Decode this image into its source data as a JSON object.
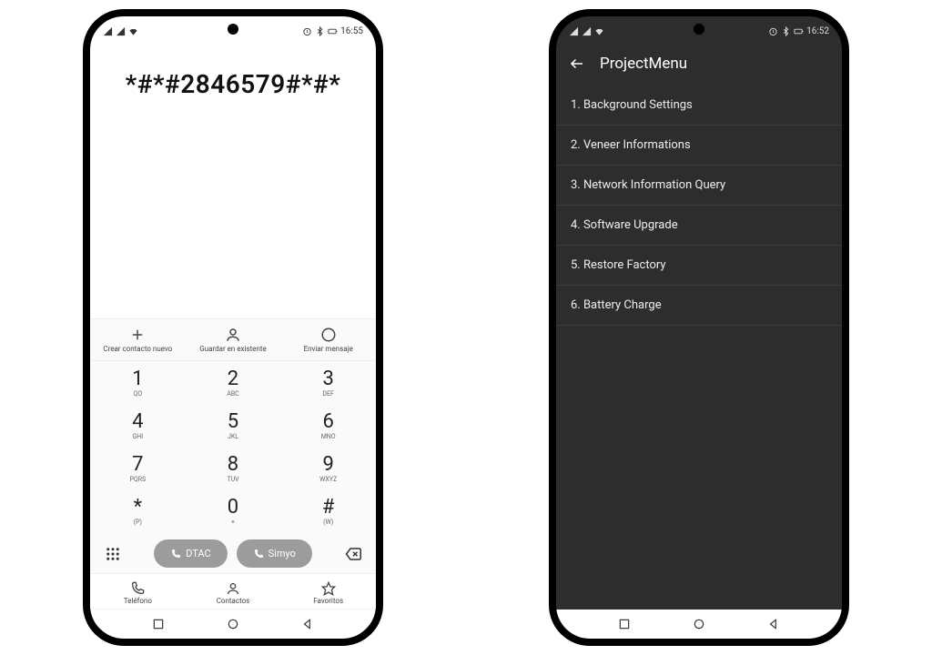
{
  "phone1": {
    "status": {
      "time": "16:55"
    },
    "dialed": "*#*#2846579#*#*",
    "actions": {
      "new_contact": "Crear contacto nuevo",
      "save_existing": "Guardar en existente",
      "send_message": "Enviar mensaje"
    },
    "keypad": [
      {
        "digit": "1",
        "letters": "QO"
      },
      {
        "digit": "2",
        "letters": "ABC"
      },
      {
        "digit": "3",
        "letters": "DEF"
      },
      {
        "digit": "4",
        "letters": "GHI"
      },
      {
        "digit": "5",
        "letters": "JKL"
      },
      {
        "digit": "6",
        "letters": "MNO"
      },
      {
        "digit": "7",
        "letters": "PQRS"
      },
      {
        "digit": "8",
        "letters": "TUV"
      },
      {
        "digit": "9",
        "letters": "WXYZ"
      },
      {
        "digit": "*",
        "letters": "(P)"
      },
      {
        "digit": "0",
        "letters": "+"
      },
      {
        "digit": "#",
        "letters": "(W)"
      }
    ],
    "call_buttons": {
      "sim1": "DTAC",
      "sim2": "Simyo"
    },
    "tabs": {
      "phone": "Teléfono",
      "contacts": "Contactos",
      "favorites": "Favoritos"
    }
  },
  "phone2": {
    "status": {
      "time": "16:52"
    },
    "title": "ProjectMenu",
    "items": [
      "1. Background Settings",
      "2. Veneer Informations",
      "3. Network Information Query",
      "4. Software Upgrade",
      "5. Restore Factory",
      "6. Battery Charge"
    ]
  }
}
